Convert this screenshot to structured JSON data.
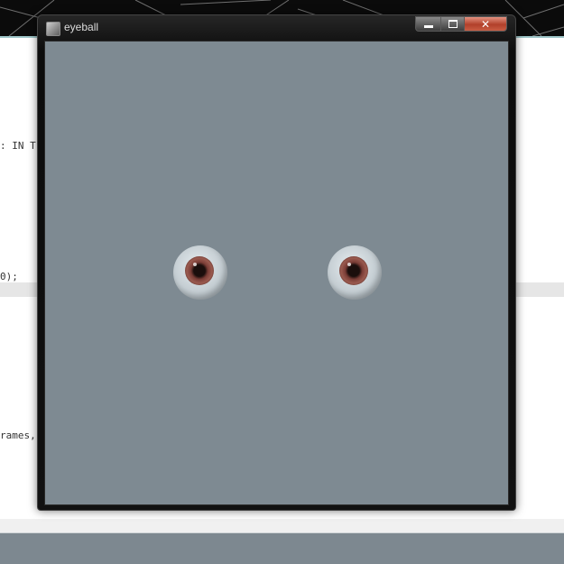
{
  "window": {
    "title": "eyeball",
    "controls": {
      "minimize_icon": "minimize-icon",
      "maximize_icon": "maximize-icon",
      "close_icon": "close-icon"
    }
  },
  "canvas": {
    "background": "#7e8a92",
    "eyes": [
      {
        "name": "left-eye",
        "iris_color": "#7a3d36"
      },
      {
        "name": "right-eye",
        "iris_color": "#7a3d36"
      }
    ]
  },
  "background_editor": {
    "code_fragments": [
      ": IN T",
      "0);",
      "rames,"
    ]
  },
  "colors": {
    "close_button": "#c85c44",
    "canvas": "#7e8a92",
    "taskbar": "#7d8890"
  }
}
